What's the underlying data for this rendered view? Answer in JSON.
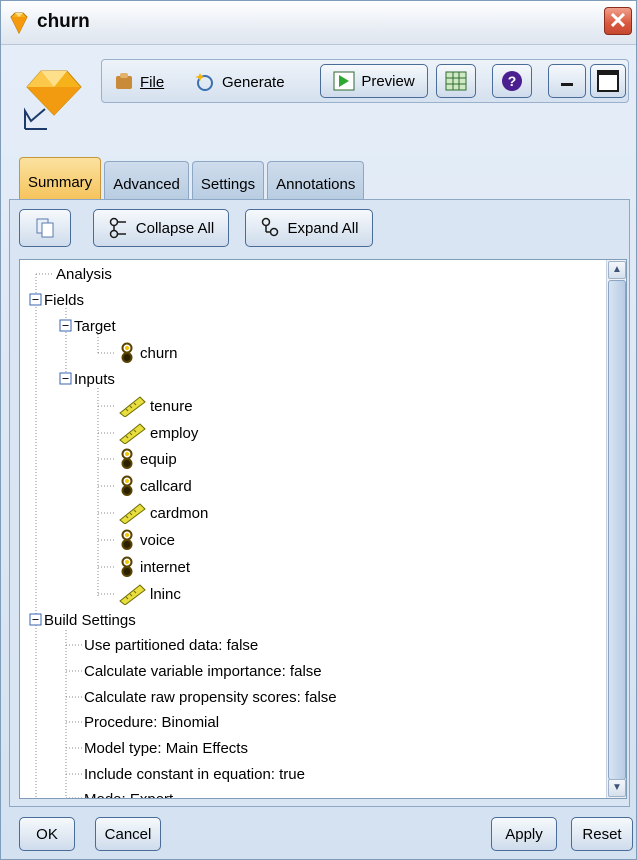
{
  "window": {
    "title": "churn"
  },
  "toolbar": {
    "file_label": "File",
    "generate_label": "Generate",
    "preview_label": "Preview"
  },
  "tabs": [
    {
      "label": "Summary",
      "active": true
    },
    {
      "label": "Advanced",
      "active": false
    },
    {
      "label": "Settings",
      "active": false
    },
    {
      "label": "Annotations",
      "active": false
    }
  ],
  "panel": {
    "collapse_label": "Collapse All",
    "expand_label": "Expand All"
  },
  "tree": {
    "analysis": "Analysis",
    "fields": "Fields",
    "target": "Target",
    "target_items": [
      "churn"
    ],
    "inputs": "Inputs",
    "input_items": [
      {
        "label": "tenure",
        "type": "continuous"
      },
      {
        "label": "employ",
        "type": "continuous"
      },
      {
        "label": "equip",
        "type": "flag"
      },
      {
        "label": "callcard",
        "type": "flag"
      },
      {
        "label": "cardmon",
        "type": "continuous"
      },
      {
        "label": "voice",
        "type": "flag"
      },
      {
        "label": "internet",
        "type": "flag"
      },
      {
        "label": "lninc",
        "type": "continuous"
      }
    ],
    "build_settings": "Build Settings",
    "build_items": [
      "Use partitioned data: false",
      "Calculate variable importance: false",
      "Calculate raw propensity scores: false",
      "Procedure: Binomial",
      "Model type: Main Effects",
      "Include constant in equation: true",
      "Mode: Expert"
    ]
  },
  "buttons": {
    "ok": "OK",
    "cancel": "Cancel",
    "apply": "Apply",
    "reset": "Reset"
  },
  "colors": {
    "active_tab": "#f5c45d",
    "close_button": "#d9583e",
    "panel_bg": "#d9e5f2"
  }
}
